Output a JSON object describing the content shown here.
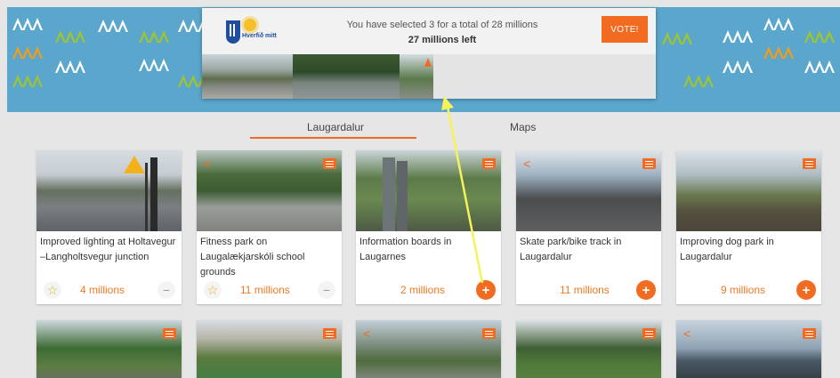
{
  "vote_panel": {
    "logo_text": "Hverfið mitt",
    "line1": "You have selected 3 for a total of 28 millions",
    "line2": "27 millions left",
    "vote_button": "VOTE!"
  },
  "tabs": [
    {
      "label": "Laugardalur",
      "active": true
    },
    {
      "label": "Maps",
      "active": false
    }
  ],
  "cards": [
    {
      "title": "Improved lighting at Holtavegur –Langholtsvegur junction",
      "price": "4 millions",
      "selected": true
    },
    {
      "title": "Fitness park on Laugalækjarskóli school grounds",
      "price": "11 millions",
      "selected": true
    },
    {
      "title": "Information boards in Laugarnes",
      "price": "2 millions",
      "selected": false
    },
    {
      "title": "Skate park/bike track in Laugardalur",
      "price": "11 millions",
      "selected": false
    },
    {
      "title": "Improving dog park in Laugardalur",
      "price": "9 millions",
      "selected": false
    }
  ],
  "colors": {
    "accent": "#f26b21",
    "hero": "#5aa6cc",
    "background": "#e6e6e6"
  },
  "icons": [
    "star-icon",
    "minus-icon",
    "plus-icon",
    "share-icon",
    "menu-icon",
    "arrow"
  ]
}
